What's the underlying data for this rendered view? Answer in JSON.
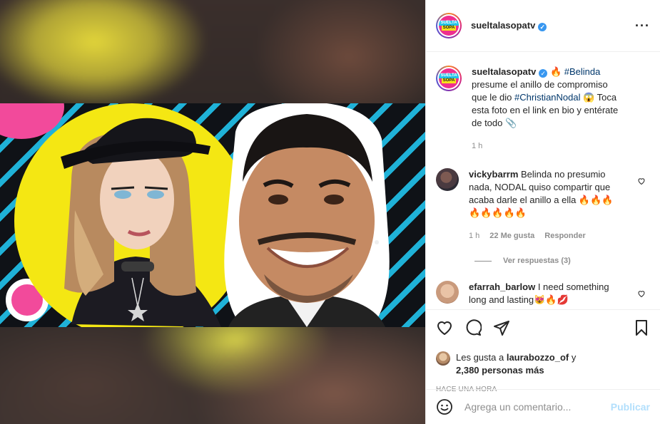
{
  "post": {
    "username": "sueltalasopatv",
    "avatar_logo_line1": "SUELTA",
    "avatar_logo_line2": "SOPA"
  },
  "caption": {
    "username": "sueltalasopatv",
    "emoji_fire": "🔥",
    "tag1": "#Belinda",
    "text1": " presume el anillo de compromiso que le dio ",
    "tag2": "#ChristianNodal",
    "text2": " 😱 Toca esta foto en el link en bio y entérate de todo 📎",
    "time": "1 h"
  },
  "comments": [
    {
      "username": "vickybarrm",
      "text": " Belinda no presumio nada, NODAL quiso compartir que acaba darle el anillo a ella 🔥🔥🔥🔥🔥🔥🔥🔥",
      "time": "1 h",
      "likes": "22 Me gusta",
      "reply": "Responder",
      "view_replies": "Ver respuestas (3)"
    },
    {
      "username": "efarrah_barlow",
      "text": " I need something long and lasting😻🔥💋"
    }
  ],
  "likes": {
    "prefix": "Les gusta a ",
    "user": "laurabozzo_of",
    "suffix": " y",
    "others": "2,380 personas más"
  },
  "timestamp": "HACE UNA HORA",
  "add_comment": {
    "placeholder": "Agrega un comentario...",
    "post_label": "Publicar"
  },
  "colors": {
    "accent_link": "#00376b",
    "publish_disabled": "#b2dffc",
    "verified": "#3897f0"
  }
}
